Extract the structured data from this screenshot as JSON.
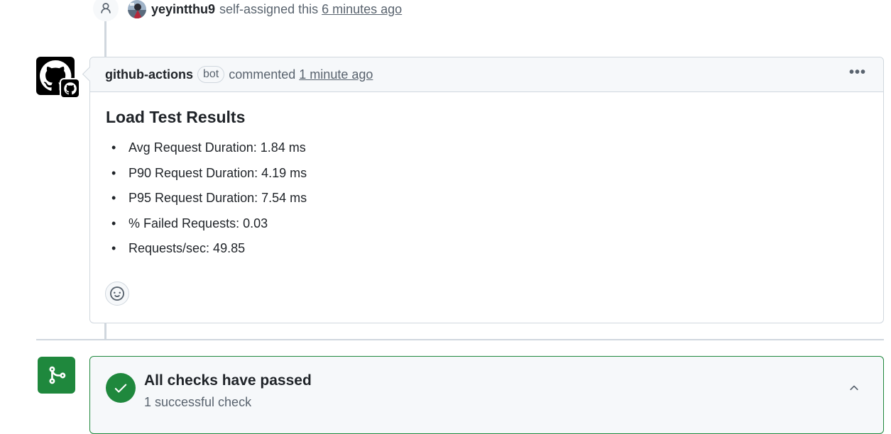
{
  "event": {
    "user": "yeyintthu9",
    "action": "self-assigned this",
    "time": "6 minutes ago"
  },
  "comment": {
    "author": "github-actions",
    "badge": "bot",
    "action": "commented",
    "time": "1 minute ago",
    "more_label": "•••",
    "title": "Load Test Results",
    "items": [
      "Avg Request Duration: 1.84 ms",
      "P90 Request Duration: 4.19 ms",
      "P95 Request Duration: 7.54 ms",
      "% Failed Requests: 0.03",
      "Requests/sec: 49.85"
    ]
  },
  "checks": {
    "title": "All checks have passed",
    "subtitle": "1 successful check"
  },
  "colors": {
    "success": "#1f883d",
    "border": "#d0d7de",
    "muted": "#59636e"
  }
}
